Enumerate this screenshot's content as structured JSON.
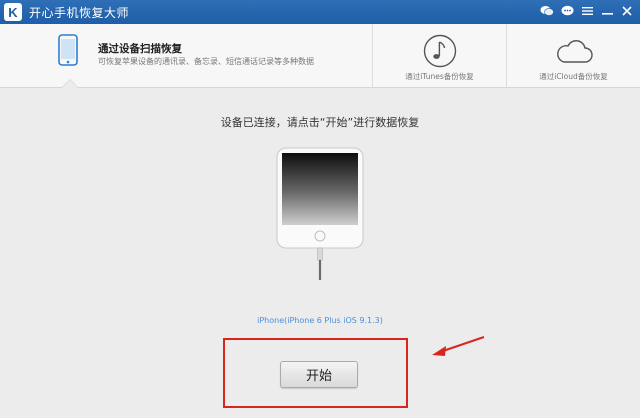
{
  "window": {
    "logo_letter": "K",
    "title": "开心手机恢复大师",
    "controls": [
      "wechat-icon",
      "chat-icon",
      "menu-icon",
      "minimize-icon",
      "close-icon"
    ]
  },
  "tabs": {
    "device": {
      "title": "通过设备扫描恢复",
      "description": "可恢复苹果设备的通讯录、备忘录、短信通话记录等多种数据",
      "icon": "phone-icon",
      "active": true
    },
    "itunes": {
      "label": "通过iTunes备份恢复",
      "icon": "music-note-icon"
    },
    "icloud": {
      "label": "通过iCloud备份恢复",
      "icon": "cloud-icon"
    }
  },
  "main": {
    "status_text": "设备已连接，请点击“开始”进行数据恢复",
    "device_name": "iPhone(iPhone 6 Plus iOS 9.1.3)",
    "start_label": "开始"
  },
  "colors": {
    "titlebar": "#1f5ea8",
    "accent_blue": "#4a90d9",
    "highlight_red": "#d9261c"
  }
}
